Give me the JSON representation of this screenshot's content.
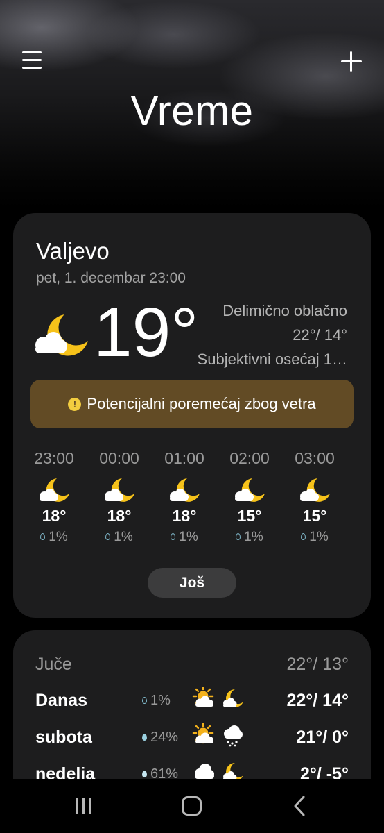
{
  "header": {
    "title": "Vreme",
    "menu_icon": "hamburger-menu-icon",
    "add_icon": "plus-icon"
  },
  "current": {
    "city": "Valjevo",
    "datetime": "pet, 1. decembar 23:00",
    "temperature": "19°",
    "condition": "Delimično oblačno",
    "high_low": "22°/ 14°",
    "feels_like": "Subjektivni osećaj 1…",
    "icon": "partly-cloudy-night-icon"
  },
  "alert": {
    "text": "Potencijalni poremećaj zbog vetra",
    "icon_glyph": "!",
    "color": "#624b25"
  },
  "hourly": [
    {
      "time": "23:00",
      "temp": "18°",
      "precip": "1%",
      "icon": "partly-cloudy-night-icon"
    },
    {
      "time": "00:00",
      "temp": "18°",
      "precip": "1%",
      "icon": "partly-cloudy-night-icon"
    },
    {
      "time": "01:00",
      "temp": "18°",
      "precip": "1%",
      "icon": "partly-cloudy-night-icon"
    },
    {
      "time": "02:00",
      "temp": "15°",
      "precip": "1%",
      "icon": "partly-cloudy-night-icon"
    },
    {
      "time": "03:00",
      "temp": "15°",
      "precip": "1%",
      "icon": "partly-cloudy-night-icon"
    }
  ],
  "more_label": "Još",
  "daily": {
    "yesterday": {
      "label": "Juče",
      "temps": "22°/ 13°"
    },
    "days": [
      {
        "label": "Danas",
        "precip": "1%",
        "temps": "22°/ 14°",
        "day_icon": "partly-sunny-icon",
        "night_icon": "partly-cloudy-night-icon",
        "drop_color": "#7fb7c9"
      },
      {
        "label": "subota",
        "precip": "24%",
        "temps": "21°/ 0°",
        "day_icon": "partly-sunny-icon",
        "night_icon": "rain-snow-icon",
        "drop_color": "#9ad0e0"
      },
      {
        "label": "nedelja",
        "precip": "61%",
        "temps": "2°/ -5°",
        "day_icon": "cloudy-icon",
        "night_icon": "partly-cloudy-night-icon",
        "drop_color": "#c6e6f0"
      }
    ]
  },
  "colors": {
    "moon": "#f6c21a",
    "sun": "#f4b21c",
    "cloud": "#ffffff",
    "card_bg": "#1d1d1e",
    "alert_bg": "#624b25"
  },
  "navbar": {
    "recents_icon": "recent-apps-icon",
    "home_icon": "home-icon",
    "back_icon": "back-icon"
  }
}
